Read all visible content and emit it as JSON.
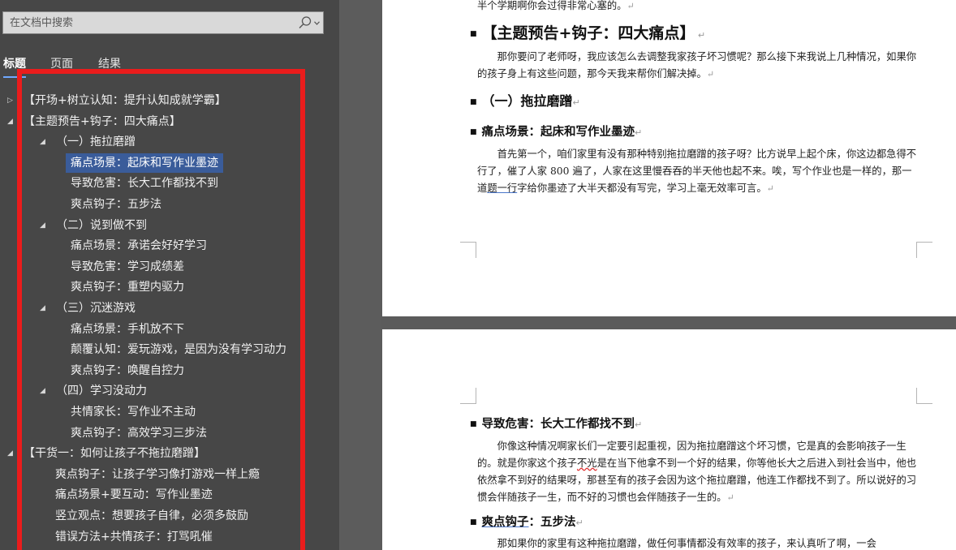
{
  "search": {
    "placeholder": "在文档中搜索",
    "icon": "magnifier-icon"
  },
  "tabs": [
    {
      "label": "标题",
      "active": true
    },
    {
      "label": "页面",
      "active": false
    },
    {
      "label": "结果",
      "active": false
    }
  ],
  "tree": [
    {
      "label": "【开场+树立认知：提升认知成就学霸】",
      "expander": "collapsed"
    },
    {
      "label": "【主题预告+钩子：四大痛点】",
      "expander": "expanded"
    },
    {
      "label": "（一）拖拉磨蹭",
      "expander": "expanded"
    },
    {
      "label": "痛点场景：起床和写作业墨迹",
      "selected": true
    },
    {
      "label": "导致危害：长大工作都找不到"
    },
    {
      "label": "爽点钩子：五步法"
    },
    {
      "label": "（二）说到做不到",
      "expander": "expanded"
    },
    {
      "label": "痛点场景：承诺会好好学习"
    },
    {
      "label": "导致危害：学习成绩差"
    },
    {
      "label": "爽点钩子：重塑内驱力"
    },
    {
      "label": "（三）沉迷游戏",
      "expander": "expanded"
    },
    {
      "label": "痛点场景：手机放不下"
    },
    {
      "label": "颠覆认知：爱玩游戏，是因为没有学习动力"
    },
    {
      "label": "爽点钩子：唤醒自控力"
    },
    {
      "label": "（四）学习没动力",
      "expander": "expanded"
    },
    {
      "label": "共情家长：写作业不主动"
    },
    {
      "label": "爽点钩子：高效学习三步法"
    },
    {
      "label": "【干货一：如何让孩子不拖拉磨蹭】",
      "expander": "expanded"
    },
    {
      "label": "爽点钩子：让孩子学习像打游戏一样上瘾"
    },
    {
      "label": "痛点场景+要互动：写作业墨迹"
    },
    {
      "label": "竖立观点：想要孩子自律，必须多鼓励"
    },
    {
      "label": "错误方法+共情孩子：打骂吼催"
    }
  ],
  "doc": {
    "page1": {
      "top_line": "半个学期啊你会过得非常心塞的。",
      "heading1": "【主题预告+钩子：四大痛点】",
      "para1": "那你要问了老师呀，我应该怎么去调整我家孩子坏习惯呢？那么接下来我说上几种情况，如果你的孩子身上有这些问题，那今天我来帮你们解决掉。",
      "heading2": "（一）拖拉磨蹭",
      "heading3": "痛点场景：起床和写作业墨迹",
      "para2_a": "首先第一个，咱们家里有没有那种特别拖拉磨蹭的孩子呀？比方说早上起个床，你这边都急得不行了，催了人家 800 遍了，人家在这里慢吞吞的半天他也起不来。唉，写个作业也是一样的，那一道",
      "para2_u": "题一行",
      "para2_b": "字给你墨迹了大半天都没有写完，学习上毫无效率可言。"
    },
    "page2": {
      "heading3a": "导致危害：长大工作都找不到",
      "para3_a": "你像这种情况啊家长们一定要引起重视，因为拖拉磨蹭这个坏习惯，它是真的会影响孩子一生的。就是你家这个孩子",
      "para3_u": "不光",
      "para3_b": "是在当下他拿不到一个好的结果，你等他长大之后进入到社会当中，他也依然拿不到好的结果呀，那甚至有的孩子会因为这个拖拉磨蹭，他连工作都找不到了。所以说好的习惯会伴随孩子一生，而不好的习惯也会伴随孩子一生的。",
      "heading3b_u": "爽点钩子",
      "heading3b_rest": "：五步法",
      "para4": "那如果你的家里有这种拖拉磨蹭，做任何事情都没有效率的孩子，来认真听了啊，一会"
    }
  },
  "colors": {
    "highlight": "#ea1c1c",
    "selection": "#3a5c9a",
    "pane": "#474747"
  }
}
